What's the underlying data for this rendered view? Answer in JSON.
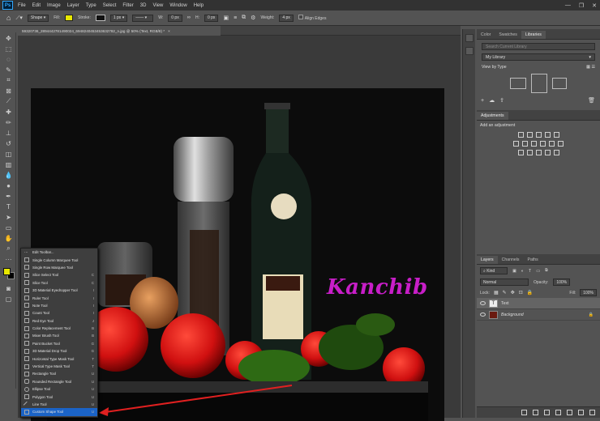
{
  "menubar": {
    "app_icon": "Ps",
    "items": [
      "File",
      "Edit",
      "Image",
      "Layer",
      "Type",
      "Select",
      "Filter",
      "3D",
      "View",
      "Window",
      "Help"
    ],
    "controls": [
      "minimize-icon",
      "restore-icon",
      "close-icon"
    ]
  },
  "options": {
    "mode": "Shape",
    "fill_label": "Fill:",
    "stroke_label": "Stroke:",
    "stroke_width": "1 px",
    "w_label": "W:",
    "w_value": "0 px",
    "h_label": "H:",
    "h_value": "0 px",
    "weight_label": "Weight:",
    "weight_value": "4 px",
    "align_edges": "Align Edges",
    "fill_color": "#e8e800"
  },
  "document": {
    "tab_title": "59320736_2894442781490024_6948240453453632782_n.jpg @ 50% (Text, RGB/8) *",
    "annotation_text": "Kanchib",
    "annotation_color": "#c81ec8"
  },
  "flyout": {
    "items": [
      {
        "label": "Edit Toolbar...",
        "key": ""
      },
      {
        "label": "Single Column Marquee Tool",
        "key": ""
      },
      {
        "label": "Single Row Marquee Tool",
        "key": ""
      },
      {
        "label": "Slice Select Tool",
        "key": "C"
      },
      {
        "label": "Slice Tool",
        "key": "C"
      },
      {
        "label": "3D Material Eyedropper Tool",
        "key": "I"
      },
      {
        "label": "Ruler Tool",
        "key": "I"
      },
      {
        "label": "Note Tool",
        "key": "I"
      },
      {
        "label": "Count Tool",
        "key": "I"
      },
      {
        "label": "Red Eye Tool",
        "key": "J"
      },
      {
        "label": "Color Replacement Tool",
        "key": "B"
      },
      {
        "label": "Mixer Brush Tool",
        "key": "B"
      },
      {
        "label": "Paint Bucket Tool",
        "key": "G"
      },
      {
        "label": "3D Material Drop Tool",
        "key": "G"
      },
      {
        "label": "Horizontal Type Mask Tool",
        "key": "T"
      },
      {
        "label": "Vertical Type Mask Tool",
        "key": "T"
      },
      {
        "label": "Rectangle Tool",
        "key": "U"
      },
      {
        "label": "Rounded Rectangle Tool",
        "key": "U"
      },
      {
        "label": "Ellipse Tool",
        "key": "U"
      },
      {
        "label": "Polygon Tool",
        "key": "U"
      },
      {
        "label": "Line Tool",
        "key": "U"
      },
      {
        "label": "Custom Shape Tool",
        "key": "U"
      }
    ],
    "selected_index": 21
  },
  "libraries": {
    "tabs": [
      "Color",
      "Swatches",
      "Libraries"
    ],
    "active_tab": "Libraries",
    "search_placeholder": "Search Current Library",
    "library": "My Library",
    "view_by": "View by Type"
  },
  "adjustments": {
    "tab": "Adjustments",
    "add_label": "Add an adjustment"
  },
  "layers": {
    "tabs": [
      "Layers",
      "Channels",
      "Paths"
    ],
    "active_tab": "Layers",
    "kind": "Kind",
    "blend_mode": "Normal",
    "opacity_label": "Opacity:",
    "opacity_value": "100%",
    "lock_label": "Lock:",
    "fill_label": "Fill:",
    "fill_value": "100%",
    "items": [
      {
        "name": "Text",
        "type": "T"
      },
      {
        "name": "Background",
        "type": ""
      }
    ]
  }
}
